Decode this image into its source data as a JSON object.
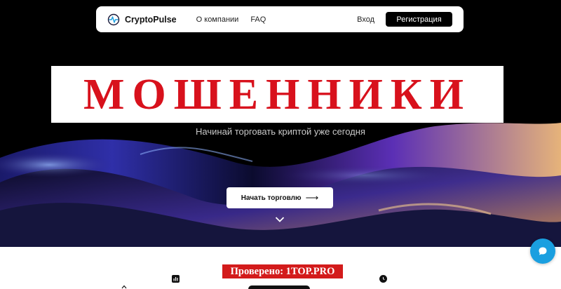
{
  "nav": {
    "brand": "CryptoPulse",
    "about": "О компании",
    "faq": "FAQ",
    "login": "Вход",
    "register": "Регистрация"
  },
  "banner": {
    "text": "МОШЕННИКИ"
  },
  "hero": {
    "subtitle": "Начинай торговать криптой уже сегодня",
    "cta": "Начать торговлю"
  },
  "stamp": {
    "text": "Проверено: 1TOP.PRO"
  },
  "colors": {
    "brand_blue": "#1a9fe0",
    "scam_red": "#d8111c",
    "stamp_red": "#d31b1b"
  },
  "icons": [
    "logo-mark-icon",
    "arrow-right-icon",
    "chevron-down-icon",
    "bar-chart-icon",
    "clock-icon",
    "chat-icon"
  ]
}
